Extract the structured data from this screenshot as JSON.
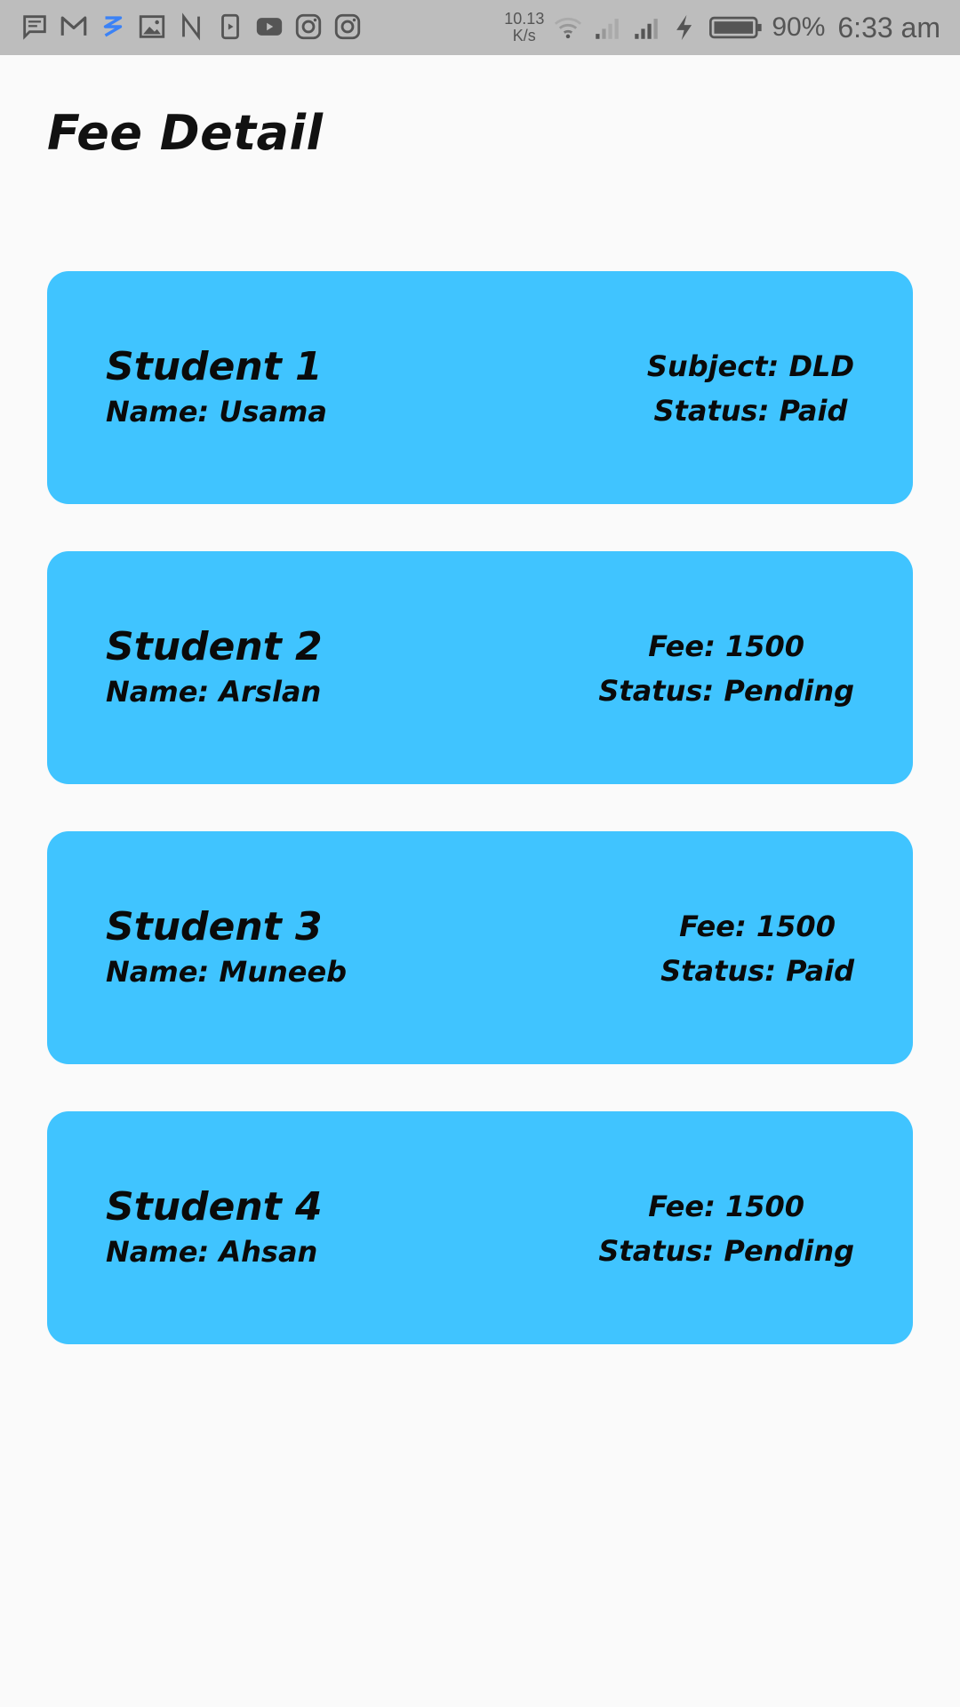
{
  "status_bar": {
    "net_speed_value": "10.13",
    "net_speed_unit": "K/s",
    "battery_percent": "90%",
    "time": "6:33 am",
    "notification_icons": [
      "message-icon",
      "gmail-icon",
      "app-s-icon",
      "gallery-icon",
      "n-app-icon",
      "media-icon",
      "youtube-icon",
      "instagram-icon",
      "instagram-icon"
    ]
  },
  "page": {
    "title": "Fee Detail"
  },
  "cards": [
    {
      "title": "Student 1",
      "name": "Name: Usama",
      "line1": "Subject: DLD",
      "line2": "Status: Paid"
    },
    {
      "title": "Student 2",
      "name": "Name: Arslan",
      "line1": "Fee: 1500",
      "line2": "Status: Pending"
    },
    {
      "title": "Student 3",
      "name": "Name: Muneeb",
      "line1": "Fee: 1500",
      "line2": "Status: Paid"
    },
    {
      "title": "Student 4",
      "name": "Name: Ahsan",
      "line1": "Fee: 1500",
      "line2": "Status: Pending"
    }
  ],
  "colors": {
    "card_background": "#40c4ff",
    "page_background": "#fafafa",
    "status_bar": "#bdbdbd"
  }
}
